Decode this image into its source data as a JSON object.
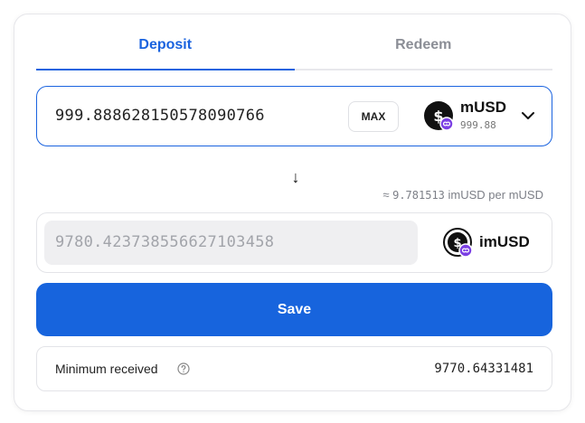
{
  "tabs": [
    {
      "label": "Deposit",
      "active": true
    },
    {
      "label": "Redeem",
      "active": false
    }
  ],
  "from": {
    "amount": "999.888628150578090766",
    "max_label": "MAX",
    "token": {
      "symbol": "mUSD",
      "balance": "999.88",
      "icon": "musd-coin-icon"
    }
  },
  "arrow": "↓",
  "rate": {
    "prefix": "≈",
    "value": "9.781513",
    "text": "imUSD per mUSD"
  },
  "to": {
    "amount": "9780.423738556627103458",
    "token": {
      "symbol": "imUSD",
      "icon": "imusd-coin-icon"
    }
  },
  "action": {
    "label": "Save"
  },
  "summary": {
    "label": "Minimum received",
    "value": "9770.64331481"
  },
  "colors": {
    "accent": "#1a63df",
    "button": "#1764dd",
    "badge": "#7b3fe4"
  }
}
